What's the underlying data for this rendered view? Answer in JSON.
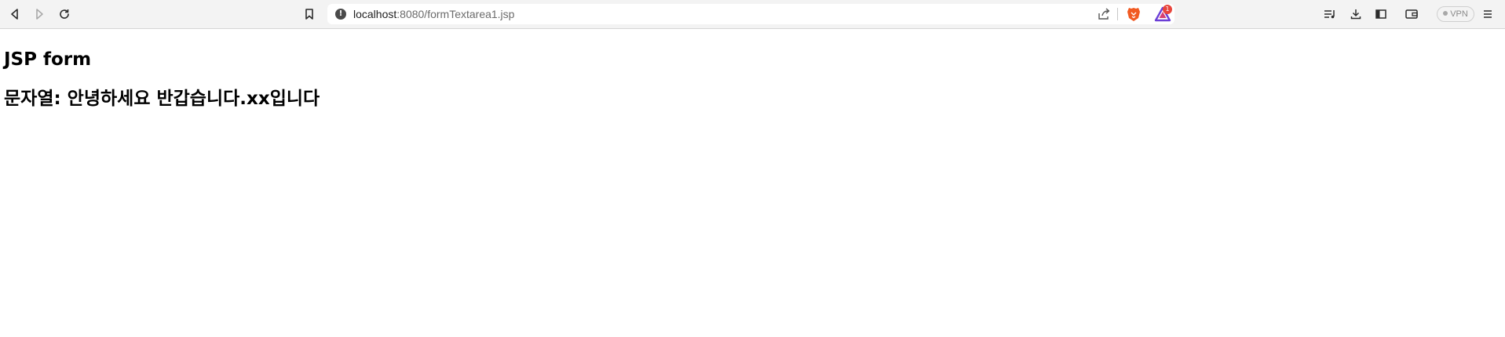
{
  "browser": {
    "address_bar": {
      "host": "localhost",
      "path": ":8080/formTextarea1.jsp"
    },
    "vpn_label": "VPN",
    "rewards_badge": "1"
  },
  "page": {
    "heading": "JSP form",
    "result_line": "문자열: 안녕하세요 반갑습니다.xx입니다"
  }
}
